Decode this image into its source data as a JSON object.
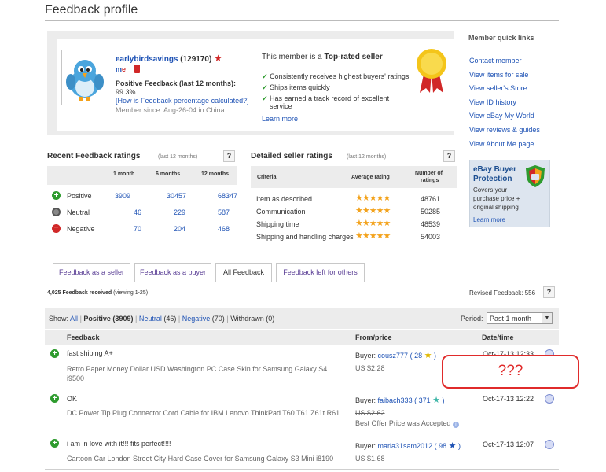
{
  "page": {
    "title": "Feedback profile"
  },
  "member": {
    "username": "earlybirdsavings",
    "score": "129170",
    "paren_open": "(",
    "paren_close": ")",
    "me_badge": "m",
    "me_badge_e": "e",
    "positive_label": "Positive Feedback (last 12 months):",
    "positive_value": "99.3%",
    "how_calc_link": "[How is Feedback percentage calculated?]",
    "member_since": "Member since: Aug-26-04 in China",
    "top_rated_prefix": "This member is a ",
    "top_rated_bold": "Top-rated seller",
    "benefits": [
      "Consistently receives highest buyers' ratings",
      "Ships items quickly",
      "Has earned a track record of excellent service"
    ],
    "learn_more": "Learn more"
  },
  "sidebar": {
    "title": "Member quick links",
    "links": [
      "Contact member",
      "View items for sale",
      "View seller's Store",
      "View ID history",
      "View eBay My World",
      "View reviews & guides",
      "View About Me page"
    ],
    "promo": {
      "title_line1": "eBay Buyer",
      "title_line2": "Protection",
      "text_lines": [
        "Covers your",
        "purchase price +",
        "original shipping"
      ],
      "learn_more": "Learn more"
    }
  },
  "recent": {
    "title": "Recent Feedback ratings",
    "period": "(last 12 months)",
    "help": "?",
    "columns": [
      "1 month",
      "6 months",
      "12 months"
    ],
    "rows": [
      {
        "label": "Positive",
        "values": [
          "3909",
          "30457",
          "68347"
        ]
      },
      {
        "label": "Neutral",
        "values": [
          "46",
          "229",
          "587"
        ]
      },
      {
        "label": "Negative",
        "values": [
          "70",
          "204",
          "468"
        ]
      }
    ]
  },
  "dsr": {
    "title": "Detailed seller ratings",
    "period": "(last 12 months)",
    "help": "?",
    "col_criteria": "Criteria",
    "col_avg": "Average rating",
    "col_num_line1": "Number of",
    "col_num_line2": "ratings",
    "star_rating": 5,
    "rows": [
      {
        "criteria": "Item as described",
        "count": "48761"
      },
      {
        "criteria": "Communication",
        "count": "50285"
      },
      {
        "criteria": "Shipping time",
        "count": "48539"
      },
      {
        "criteria": "Shipping and handling charges",
        "count": "54003"
      }
    ]
  },
  "tabs": [
    "Feedback as a seller",
    "Feedback as a buyer",
    "All Feedback",
    "Feedback left for others"
  ],
  "active_tab": "All Feedback",
  "summary": {
    "received": "4,025 Feedback received",
    "viewing": "(viewing 1-25)",
    "revised": "Revised Feedback: 556",
    "help": "?"
  },
  "filters": {
    "show_label": "Show:",
    "all": "All",
    "positive": "Positive (3909)",
    "neutral": "Neutral",
    "neutral_count": "(46)",
    "negative": "Negative",
    "negative_count": "(70)",
    "withdrawn": "Withdrawn (0)",
    "sep": "|",
    "period_label": "Period:",
    "period_value": "Past 1 month"
  },
  "table": {
    "col_feedback": "Feedback",
    "col_from": "From/price",
    "col_date": "Date/time",
    "rows": [
      {
        "comment": "fast shiping A+",
        "item": "Retro Paper Money Dollar USD Washington PC Case Skin for Samsung Galaxy S4 i9500",
        "buyer_label": "Buyer:",
        "buyer": "cousz777",
        "buyer_score": "28",
        "price": "US $2.28",
        "date": "Oct-17-13 12:33"
      },
      {
        "comment": "OK",
        "item": "DC Power Tip Plug Connector Cord Cable for IBM Lenovo ThinkPad T60 T61 Z61t R61",
        "buyer_label": "Buyer:",
        "buyer": "faibach333",
        "buyer_score": "371",
        "price": "US $2.62",
        "price_note": "Best Offer Price was Accepted",
        "date": "Oct-17-13 12:22"
      },
      {
        "comment": "i am in love with it!!! fits perfect!!!!",
        "item": "Cartoon Car London Street City Hard Case Cover for Samsung Galaxy S3 Mini i8190",
        "buyer_label": "Buyer:",
        "buyer": "maria31sam2012",
        "buyer_score": "98",
        "price": "US $1.68",
        "date": "Oct-17-13 12:07"
      }
    ]
  },
  "annotation": "???",
  "colors": {
    "link": "#1f53b5",
    "star": "#f3a21b",
    "positive": "#2e9b2e",
    "negative": "#d12828",
    "annotation": "#e02b2b"
  }
}
